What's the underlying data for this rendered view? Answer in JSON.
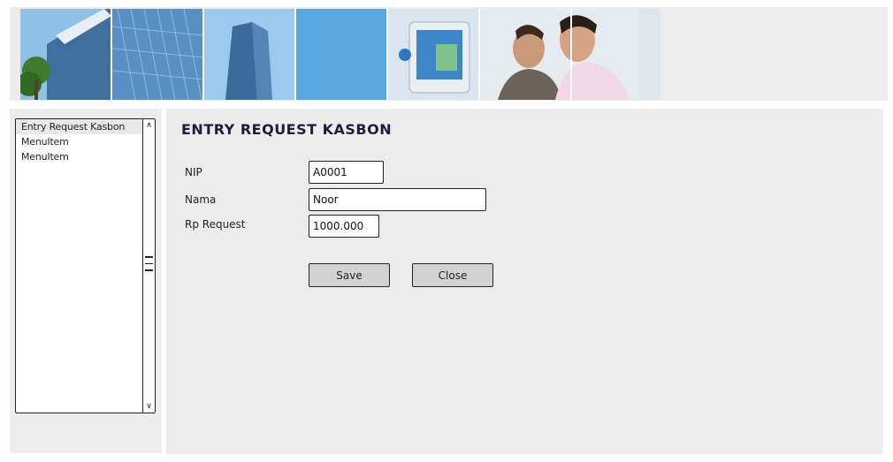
{
  "sidebar": {
    "items": [
      {
        "label": "Entry Request Kasbon",
        "selected": true
      },
      {
        "label": "MenuItem",
        "selected": false
      },
      {
        "label": "MenuItem",
        "selected": false
      }
    ],
    "scroll_up_icon": "chevron-up-icon",
    "scroll_down_icon": "chevron-down-icon"
  },
  "form": {
    "title": "ENTRY REQUEST KASBON",
    "nip_label": "NIP",
    "nip_value": "A0001",
    "nama_label": "Nama",
    "nama_value": "Noor",
    "rp_request_label": "Rp Request",
    "rp_request_value": "1000.000",
    "save_label": "Save",
    "close_label": "Close"
  },
  "colors": {
    "panel_background": "#ececec",
    "button_background": "#d2d2d2",
    "title_color": "#1e1e3a"
  }
}
